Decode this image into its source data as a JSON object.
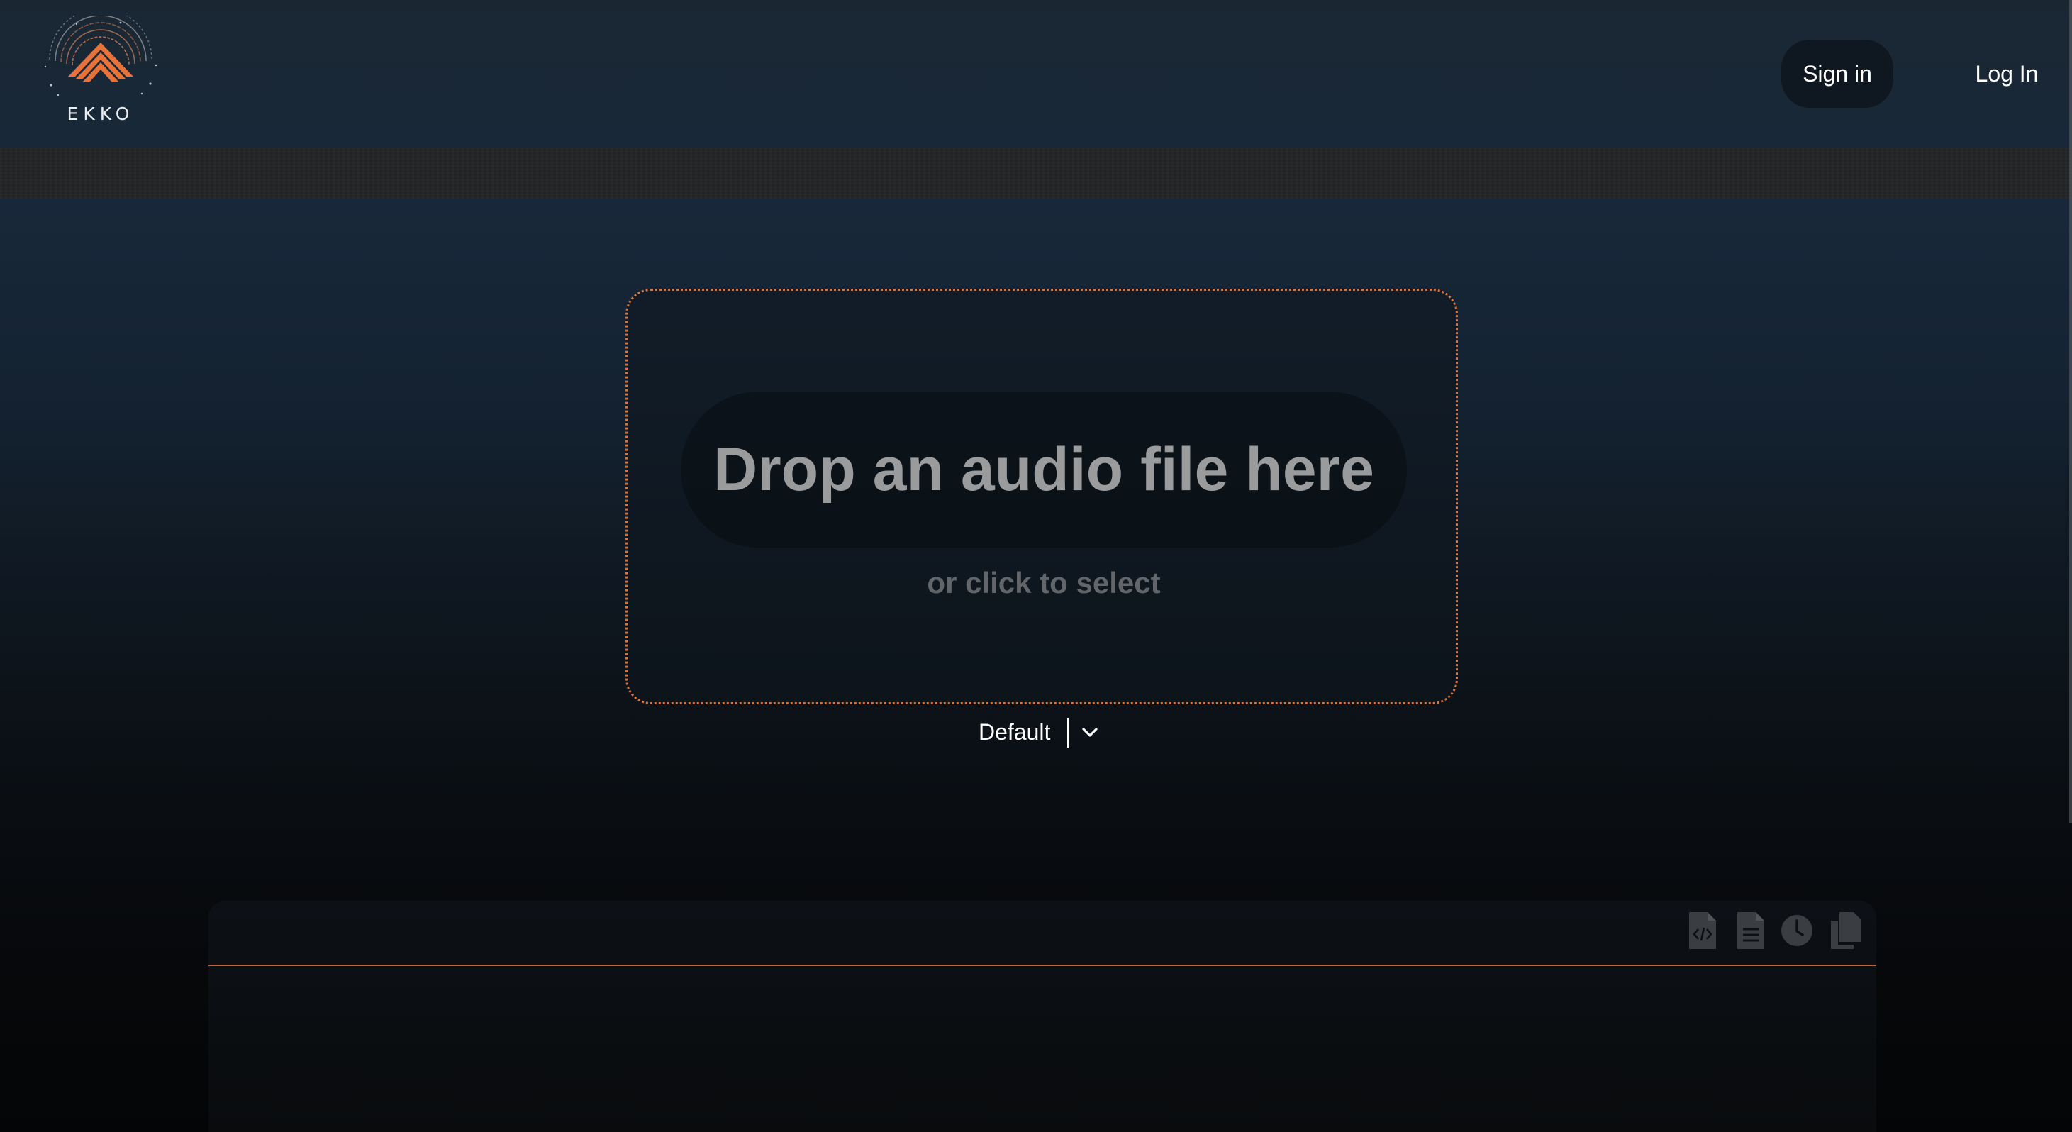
{
  "brand": {
    "name": "EKKO",
    "logo_icon": "ekko-mountain-logo",
    "accent_color": "#e8733a"
  },
  "header": {
    "sign_in_label": "Sign in",
    "log_in_label": "Log In"
  },
  "dropzone": {
    "title": "Drop an audio file here",
    "subtitle": "or click to select",
    "border_color": "#d9743a"
  },
  "preset": {
    "selected": "Default",
    "icon": "chevron-down-icon"
  },
  "panel": {
    "toolbar_icons": [
      {
        "name": "code-file-icon"
      },
      {
        "name": "document-icon"
      },
      {
        "name": "clock-icon"
      },
      {
        "name": "copy-icon"
      }
    ]
  }
}
